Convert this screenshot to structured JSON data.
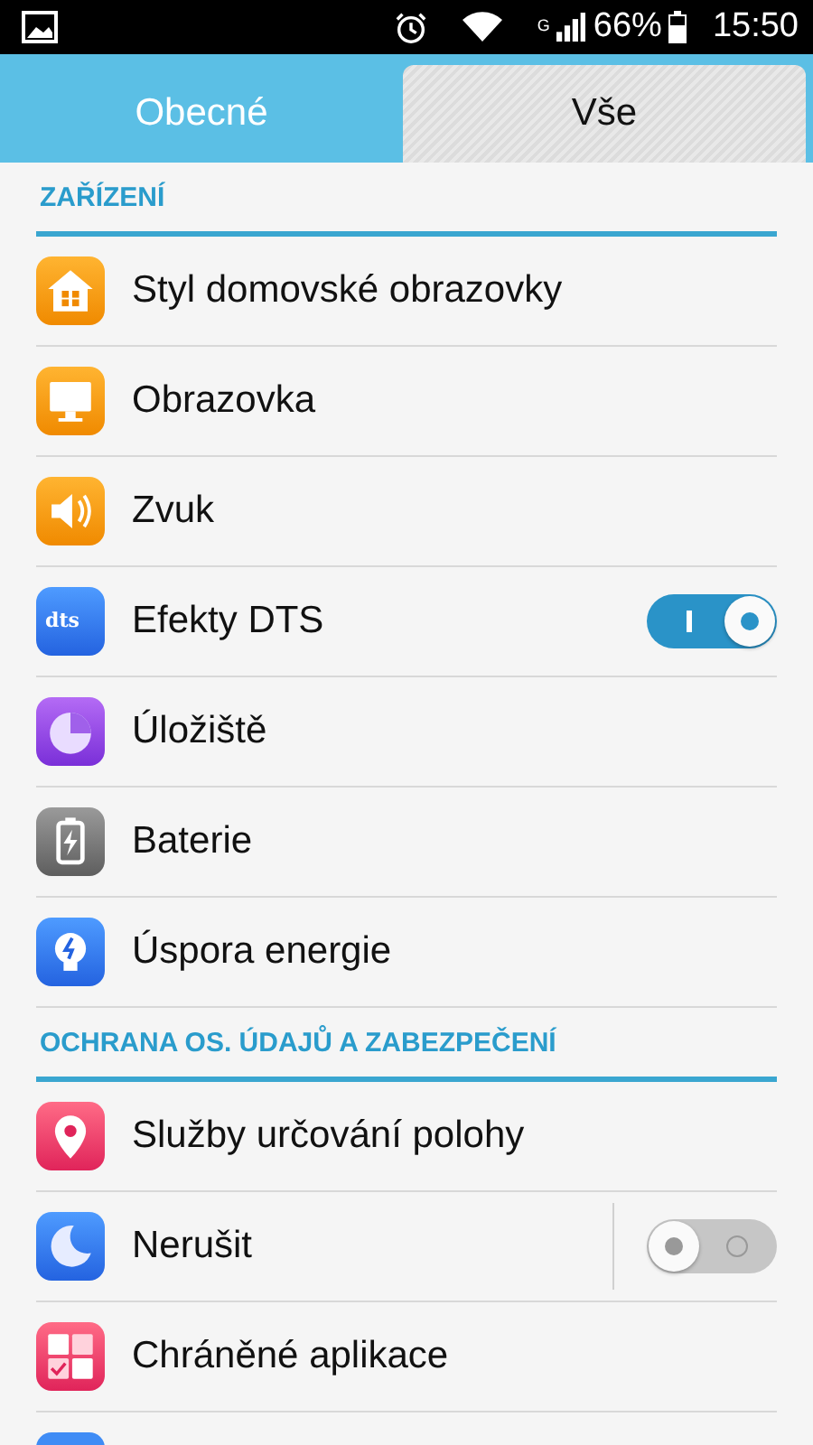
{
  "status_bar": {
    "network": "G",
    "battery": "66%",
    "time": "15:50"
  },
  "tabs": [
    {
      "label": "Obecné",
      "selected": false
    },
    {
      "label": "Vše",
      "selected": true
    }
  ],
  "sections": [
    {
      "title": "ZAŘÍZENÍ",
      "items": [
        {
          "label": "Styl domovské obrazovky",
          "kind": "link"
        },
        {
          "label": "Obrazovka",
          "kind": "link"
        },
        {
          "label": "Zvuk",
          "kind": "link"
        },
        {
          "label": "Efekty DTS",
          "kind": "toggle",
          "on": true,
          "icon_text": "dts"
        },
        {
          "label": "Úložiště",
          "kind": "link"
        },
        {
          "label": "Baterie",
          "kind": "link"
        },
        {
          "label": "Úspora energie",
          "kind": "link"
        }
      ]
    },
    {
      "title": "OCHRANA OS. ÚDAJŮ A ZABEZPEČENÍ",
      "items": [
        {
          "label": "Služby určování polohy",
          "kind": "link"
        },
        {
          "label": "Nerušit",
          "kind": "split-toggle",
          "on": false
        },
        {
          "label": "Chráněné aplikace",
          "kind": "link"
        }
      ]
    }
  ]
}
